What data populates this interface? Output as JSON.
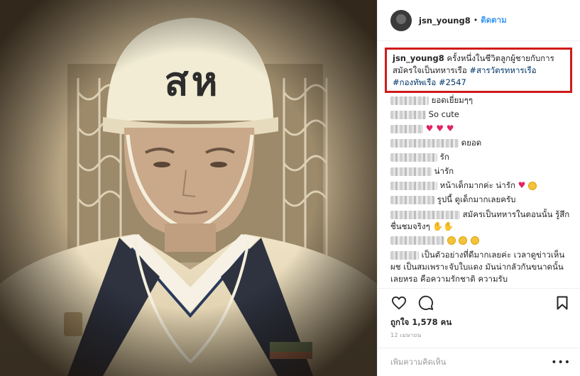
{
  "photo": {
    "helmet_text": "สห"
  },
  "header": {
    "username": "jsn_young8",
    "separator": "•",
    "follow_label": "ติดตาม"
  },
  "caption": {
    "username": "jsn_young8",
    "text": "ครั้งหนึ่งในชีวิตลูกผู้ชายกับการสมัครใจเป็นทหารเรือ",
    "hashtags": [
      "#สารวัตรทหารเรือ",
      "#กองทัพเรือ",
      "#2547"
    ]
  },
  "comments": [
    {
      "text": "ยอดเยี่ยมๆๆ"
    },
    {
      "text": "So cute"
    },
    {
      "text": "♥ ♥ ♥"
    },
    {
      "text": "ดยอด"
    },
    {
      "text": "รัก"
    },
    {
      "text": "น่ารัก"
    },
    {
      "text": "หน้าเด็กมากค่ะ น่ารัก"
    },
    {
      "text": "รูปนี้ ดูเด็กมากเลยครับ"
    },
    {
      "text": "สมัครเป็นทหารในตอนนั้น รู้สึกชื่นชมจริงๆ"
    },
    {
      "text": ""
    },
    {
      "text": "เป็นตัวอย่างที่ดีมากเลยค่ะ เวลาดูข่าวเห็น ผช เป็นสมเพราะจับใบแดง มันน่ากลัวกันขนาดนั้นเลยหรอ คือความรักชาติ ความรับ"
    }
  ],
  "actions": {
    "like": "heart-outline-icon",
    "comment": "comment-bubble-icon",
    "save": "bookmark-icon"
  },
  "likes_text": "ถูกใจ 1,578 คน",
  "date_text": "12 เมษายน",
  "add_comment": {
    "placeholder": "เพิ่มความคิดเห็น",
    "more": "•••"
  },
  "colors": {
    "link": "#3897f0",
    "hashtag": "#003569",
    "highlight_box": "#d11a1a"
  }
}
